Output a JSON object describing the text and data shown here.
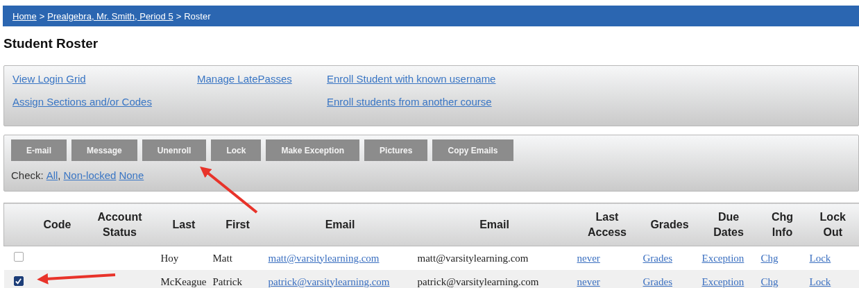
{
  "breadcrumb": {
    "separator": ">",
    "items": [
      {
        "label": "Home",
        "link": true
      },
      {
        "label": "Prealgebra, Mr. Smith, Period 5",
        "link": true
      },
      {
        "label": "Roster",
        "link": false
      }
    ]
  },
  "title": "Student Roster",
  "link_columns": [
    [
      "View Login Grid",
      "Assign Sections and/or Codes"
    ],
    [
      "Manage LatePasses"
    ],
    [
      "Enroll Student with known username",
      "Enroll students from another course"
    ]
  ],
  "buttons": [
    "E-mail",
    "Message",
    "Unenroll",
    "Lock",
    "Make Exception",
    "Pictures",
    "Copy Emails"
  ],
  "check": {
    "label": "Check:",
    "options": [
      {
        "label": "All",
        "after": ","
      },
      {
        "label": "Non-locked"
      },
      {
        "label": "None"
      }
    ]
  },
  "table": {
    "columns": [
      "Code",
      "Account Status",
      "Last",
      "First",
      "Email",
      "Email",
      "Last Access",
      "Grades",
      "Due Dates",
      "Chg Info",
      "Lock Out"
    ],
    "rows": [
      {
        "checked": false,
        "last": "Hoy",
        "first": "Matt",
        "email_link": "matt@varsitylearning.com",
        "email": "matt@varsitylearning.com",
        "last_access": "never",
        "grades": "Grades",
        "due_dates": "Exception",
        "chg_info": "Chg",
        "lock_out": "Lock"
      },
      {
        "checked": true,
        "last": "McKeague",
        "first": "Patrick",
        "email_link": "patrick@varsitylearning.com",
        "email": "patrick@varsitylearning.com",
        "last_access": "never",
        "grades": "Grades",
        "due_dates": "Exception",
        "chg_info": "Chg",
        "lock_out": "Lock"
      }
    ]
  }
}
